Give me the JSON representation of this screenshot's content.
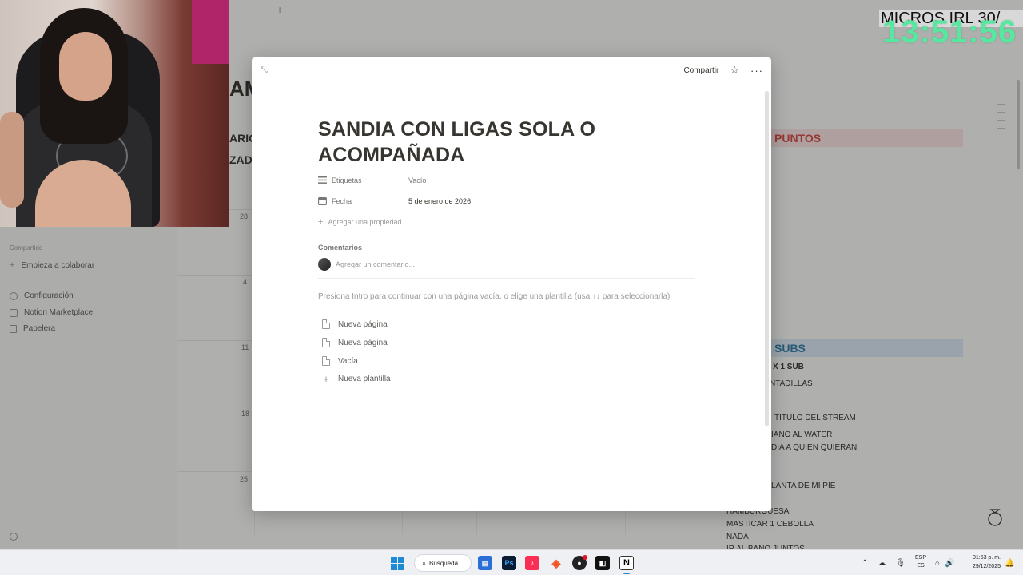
{
  "modal": {
    "share_label": "Compartir",
    "title": "SANDIA CON LIGAS SOLA O ACOMPAÑADA",
    "properties": [
      {
        "name": "Etiquetas",
        "value": "Vacío"
      },
      {
        "name": "Fecha",
        "value": "5 de enero de 2026"
      }
    ],
    "add_property_label": "Agregar una propiedad",
    "comments_title": "Comentarios",
    "comment_placeholder": "Agregar un comentario...",
    "hint": "Presiona Intro para continuar con una página vacía, o elige una plantilla (usa ↑↓ para seleccionarla)",
    "templates": [
      {
        "label": "Nueva página",
        "icon": "page-icon"
      },
      {
        "label": "Nueva página",
        "icon": "page-icon"
      },
      {
        "label": "Vacía",
        "icon": "page-icon"
      },
      {
        "label": "Nueva plantilla",
        "icon": "plus-icon"
      }
    ]
  },
  "sidebar": {
    "section_label": "Compartido",
    "items": [
      {
        "label": "Empieza a colaborar",
        "icon": "plus-icon"
      },
      {
        "label": "Configuración",
        "icon": "gear-icon"
      },
      {
        "label": "Notion Marketplace",
        "icon": "marketplace-icon"
      },
      {
        "label": "Papelera",
        "icon": "trash-icon"
      }
    ]
  },
  "background": {
    "title_fragment": "AM",
    "fragment_2": "ARIO",
    "fragment_3": "ZADO",
    "calendar_numbers": [
      "28",
      "4",
      "11",
      "18",
      "25"
    ],
    "puntos_header": "PUNTOS",
    "subs_header": "SUBS",
    "subs_items": [
      "X 1 SUB",
      "NTADILLAS",
      "TITULO DEL STREAM",
      "IANO AL WATER",
      "DIA A QUIEN QUIERAN",
      "LANTA DE MI PIE",
      "HAMBURGUESA",
      "MASTICAR 1 CEBOLLA",
      "NADA",
      "IR AL BAÑO JUNTOS"
    ]
  },
  "overlay": {
    "micros_text": "MICROS IRL 30/",
    "clock": "13:51:56"
  },
  "taskbar": {
    "search_label": "Búsqueda",
    "lang_top": "ESP",
    "lang_bottom": "ES",
    "time": "01:53 p. m.",
    "date": "29/12/2025",
    "apps": [
      "windows-start",
      "search",
      "file-explorer",
      "photoshop",
      "music",
      "brave",
      "obs",
      "capcut",
      "notion"
    ]
  },
  "colors": {
    "clock": "#57e8a0",
    "puntos_bg": "#fbe4e4",
    "puntos_text": "#d44c47",
    "subs_bg": "#dce9f5",
    "subs_text": "#337ea9"
  }
}
